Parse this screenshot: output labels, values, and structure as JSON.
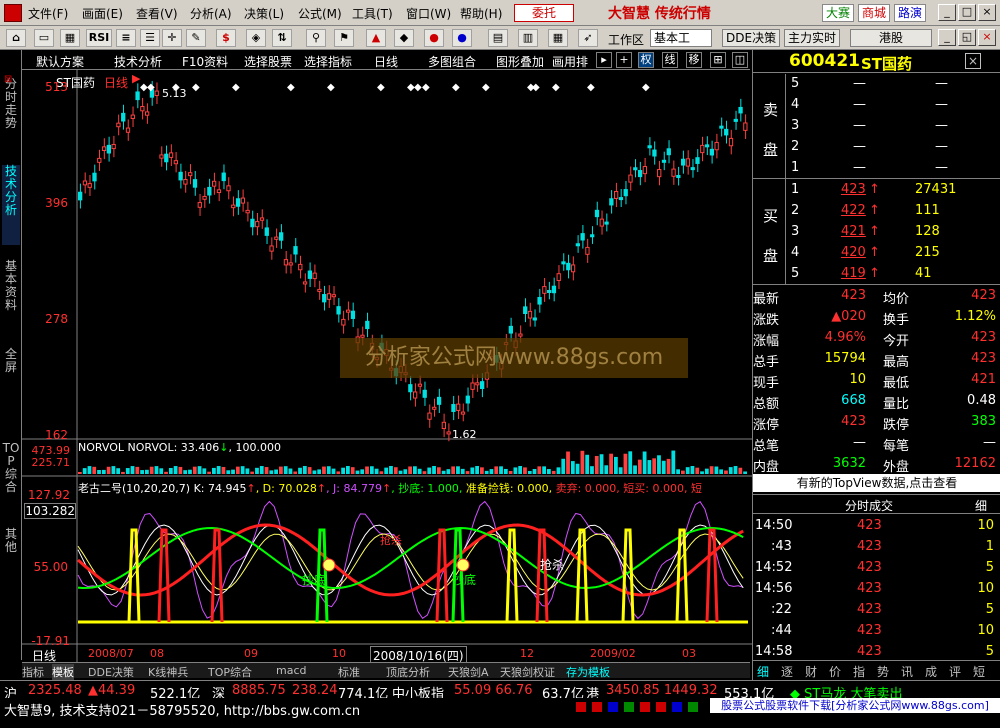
{
  "menu": {
    "items": [
      "文件(F)",
      "画面(E)",
      "查看(V)",
      "分析(A)",
      "决策(L)",
      "公式(M)",
      "工具(T)",
      "窗口(W)",
      "帮助(H)"
    ],
    "trade": "委托",
    "brand": "大智慧 传统行情",
    "tags": [
      "大赛",
      "商城",
      "路演"
    ],
    "win": [
      "_",
      "□",
      "×"
    ]
  },
  "toolbar": {
    "workspace": "工作区",
    "preset": "基本工",
    "dde": "DDE决策",
    "realtime": "主力实时",
    "hk": "港股"
  },
  "charttabs": {
    "items": [
      "默认方案",
      "技术分析",
      "F10资料",
      "选择股票",
      "选择指标",
      "日线",
      "多图组合",
      "图形叠加",
      "画用排"
    ],
    "right": [
      "权",
      "线",
      "移"
    ]
  },
  "lefttabs": [
    "分时走势",
    "技术分析",
    "基本资料",
    "全屏",
    "TOP综合",
    "其他"
  ],
  "chart": {
    "title": "ST国药",
    "period": "日线",
    "high_label": "5.13",
    "low_label": "1.62",
    "yaxis": [
      "513",
      "396",
      "278",
      "162"
    ],
    "vol_title": "NORVOL NORVOL: 33.406",
    "vol_arrow": "↓",
    "vol_tail": ", 100.000",
    "vol_axis": [
      "473.99",
      "225.71"
    ],
    "ind_title": "老古二号(10,20,20,7)",
    "ind_k": "K: 74.945",
    "ind_k_arrow": "↑",
    "ind_d": ", D: 70.028",
    "ind_d_arrow": "↑",
    "ind_j": ", J: 84.779",
    "ind_j_arrow": "↑",
    "ind_cd": ", 抄底: 1.000,",
    "ind_zb": "准备捡钱: 0.000,",
    "ind_mq": "卖弃: 0.000, 短买: 0.000, 短",
    "ind_axis": [
      "127.92",
      "103.282",
      "55.00",
      "-17.91"
    ],
    "date_labels": [
      "2008/07",
      "08",
      "09",
      "10",
      "2008/10/16(四)",
      "12",
      "2009/02",
      "03"
    ],
    "annotations": [
      "抄底",
      "抄底",
      "抄底",
      "抢杀"
    ],
    "watermark": "分析家公式网www.88gs.com"
  },
  "quote": {
    "code": "600421",
    "name": "ST国药",
    "sell_label": "卖盘",
    "buy_label": "买盘",
    "sell": [
      {
        "lv": "5",
        "p": "—",
        "v": "—"
      },
      {
        "lv": "4",
        "p": "—",
        "v": "—"
      },
      {
        "lv": "3",
        "p": "—",
        "v": "—"
      },
      {
        "lv": "2",
        "p": "—",
        "v": "—"
      },
      {
        "lv": "1",
        "p": "—",
        "v": "—"
      }
    ],
    "buy": [
      {
        "lv": "1",
        "p": "423",
        "v": "27431"
      },
      {
        "lv": "2",
        "p": "422",
        "v": "111"
      },
      {
        "lv": "3",
        "p": "421",
        "v": "128"
      },
      {
        "lv": "4",
        "p": "420",
        "v": "215"
      },
      {
        "lv": "5",
        "p": "419",
        "v": "41"
      }
    ],
    "stats": [
      {
        "l": "最新",
        "v": "423",
        "l2": "均价",
        "v2": "423"
      },
      {
        "l": "涨跌",
        "v": "▲020",
        "l2": "换手",
        "v2": "1.12%"
      },
      {
        "l": "涨幅",
        "v": "4.96%",
        "l2": "今开",
        "v2": "423"
      },
      {
        "l": "总手",
        "v": "15794",
        "l2": "最高",
        "v2": "423"
      },
      {
        "l": "现手",
        "v": "10",
        "l2": "最低",
        "v2": "421"
      },
      {
        "l": "总额",
        "v": "668",
        "l2": "量比",
        "v2": "0.48"
      },
      {
        "l": "涨停",
        "v": "423",
        "l2": "跌停",
        "v2": "383"
      },
      {
        "l": "总笔",
        "v": "—",
        "l2": "每笔",
        "v2": "—"
      },
      {
        "l": "内盘",
        "v": "3632",
        "l2": "外盘",
        "v2": "12162"
      }
    ],
    "topview": "有新的TopView数据,点击查看",
    "ticks_title": "分时成交",
    "ticks_btn": "细",
    "ticks": [
      {
        "t": "14:50",
        "p": "423",
        "v": "10"
      },
      {
        "t": ":43",
        "p": "423",
        "v": "1"
      },
      {
        "t": "14:52",
        "p": "423",
        "v": "5"
      },
      {
        "t": "14:56",
        "p": "423",
        "v": "10"
      },
      {
        "t": ":22",
        "p": "423",
        "v": "5"
      },
      {
        "t": ":44",
        "p": "423",
        "v": "10"
      },
      {
        "t": "14:58",
        "p": "423",
        "v": "5"
      }
    ],
    "rtabs": [
      "细",
      "逐",
      "财",
      "价",
      "指",
      "势",
      "讯",
      "成",
      "评",
      "短"
    ]
  },
  "btabs": [
    "指标",
    "模板",
    "DDE决策",
    "K线神兵",
    "TOP综合",
    "macd",
    "标准",
    "顶底分析",
    "天狼剑A",
    "天狼剑权证",
    "存为模板"
  ],
  "ticker": {
    "sh_l": "沪",
    "sh_v": "2325.48",
    "sh_c": "▲44.39",
    "sh_a": "522.1亿",
    "sz_l": "深",
    "sz_v": "8885.75",
    "sz_c": "238.24",
    "sz_a": "774.1亿",
    "zx_l": "中小板指",
    "zx_v": "55.09 66.76",
    "zx_a": "63.7亿",
    "hk_l": "港",
    "hk_v": "3450.85 1449.32",
    "hk_a": "553.1亿",
    "news": "◆ ST马龙  大笔卖出"
  },
  "status": {
    "left": "大智慧9, 技术支持021－58795520, http://bbs.gw.com.cn",
    "right": "股票公式股票软件下载[分析家公式网www.88gs.com]"
  }
}
